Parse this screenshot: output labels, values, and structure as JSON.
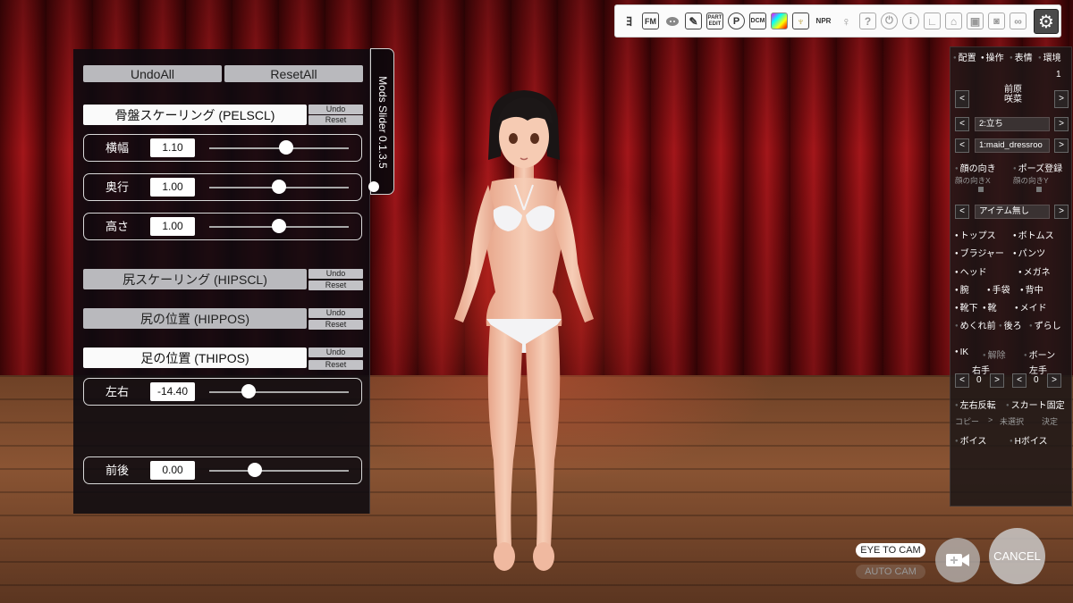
{
  "mods_panel": {
    "undo_all": "UndoAll",
    "reset_all": "ResetAll",
    "tab_label": "Mods Slider 0.1.3.5",
    "undo": "Undo",
    "reset": "Reset",
    "sections": [
      {
        "title": "骨盤スケーリング (PELSCL)",
        "rows": [
          {
            "label": "横幅",
            "value": "1.10",
            "slider": 0.55
          },
          {
            "label": "奥行",
            "value": "1.00",
            "slider": 0.5
          },
          {
            "label": "高さ",
            "value": "1.00",
            "slider": 0.5
          }
        ]
      },
      {
        "title": "尻スケーリング (HIPSCL)",
        "rows": []
      },
      {
        "title": "尻の位置 (HIPPOS)",
        "rows": []
      },
      {
        "title": "足の位置 (THIPOS)",
        "rows": [
          {
            "label": "左右",
            "value": "-14.40",
            "slider": 0.28
          },
          {
            "label": "前後",
            "value": "0.00",
            "slider": 0.33
          }
        ]
      }
    ]
  },
  "toolbar": {
    "icons": [
      {
        "name": "yotogi-icon",
        "glyph": "ﾖ"
      },
      {
        "name": "fm-icon",
        "glyph": "FM"
      },
      {
        "name": "pig-icon",
        "glyph": "•"
      },
      {
        "name": "wrench-icon",
        "glyph": "✎"
      },
      {
        "name": "part-edit-icon",
        "glyph": "PART EDIT"
      },
      {
        "name": "p-icon",
        "glyph": "P"
      },
      {
        "name": "dcm-icon",
        "glyph": "DCM"
      },
      {
        "name": "color-palette-icon",
        "glyph": ""
      },
      {
        "name": "trophy-icon",
        "glyph": "♆"
      },
      {
        "name": "npr-icon",
        "glyph": "NPR"
      },
      {
        "name": "key-icon",
        "glyph": "♀"
      },
      {
        "name": "help-icon",
        "glyph": "?"
      },
      {
        "name": "power-icon",
        "glyph": "⏻"
      },
      {
        "name": "info-icon",
        "glyph": "i"
      },
      {
        "name": "graph-icon",
        "glyph": "∟"
      },
      {
        "name": "shop-icon",
        "glyph": "⌂"
      },
      {
        "name": "profile-icon",
        "glyph": "▣"
      },
      {
        "name": "camera-icon",
        "glyph": "◙"
      },
      {
        "name": "link-icon",
        "glyph": "∞"
      }
    ],
    "settings_icon": "⚙"
  },
  "right_panel": {
    "tabs": [
      "配置",
      "操作",
      "表情",
      "環境"
    ],
    "tab_states": [
      false,
      true,
      false,
      false
    ],
    "number": "1",
    "character_name": "前原\n咲菜",
    "pose": "2:立ち",
    "dress": "1:maid_dressroo",
    "face_direction": "顔の向き",
    "pose_register": "ポーズ登録",
    "face_dir_x": "顔の向きX",
    "face_dir_y": "顔の向きY",
    "item": "アイテム無し",
    "clothing": [
      {
        "label": "トップス",
        "on": true
      },
      {
        "label": "ボトムス",
        "on": true
      },
      {
        "label": "ブラジャー",
        "on": true
      },
      {
        "label": "パンツ",
        "on": true
      },
      {
        "label": "ヘッド",
        "on": true
      },
      {
        "label": "メガネ",
        "on": true
      },
      {
        "label": "腕",
        "on": true
      },
      {
        "label": "手袋",
        "on": true
      },
      {
        "label": "背中",
        "on": true
      },
      {
        "label": "靴下",
        "on": true
      },
      {
        "label": "靴",
        "on": true
      },
      {
        "label": "メイド",
        "on": true
      },
      {
        "label": "めくれ前",
        "on": false
      },
      {
        "label": "後ろ",
        "on": false
      },
      {
        "label": "ずらし",
        "on": false
      }
    ],
    "ik": "IK",
    "release": "解除",
    "bone": "ボーン",
    "right_hand": "右手",
    "left_hand": "左手",
    "right_hand_value": "0",
    "left_hand_value": "0",
    "mirror": "左右反転",
    "skirt_fix": "スカート固定",
    "copy": "コピー",
    "unselected": "未選択",
    "decide": "決定",
    "voice": "ボイス",
    "h_voice": "Hボイス"
  },
  "camera": {
    "eye_to_cam": "EYE TO CAM",
    "auto_cam": "AUTO CAM",
    "cancel": "CANCEL"
  },
  "colors": {
    "curtain": "#8a1014",
    "floor": "#7d4b2d",
    "panel_bg": "#0c0a10",
    "button_grey": "#b9b9bd"
  }
}
